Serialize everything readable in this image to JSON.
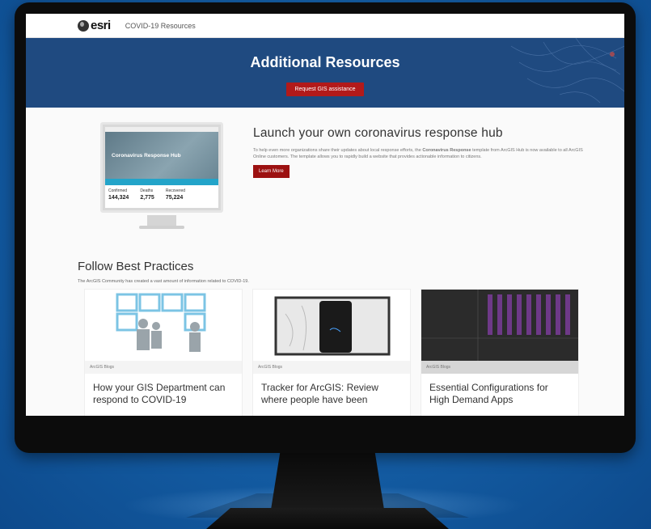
{
  "nav": {
    "logo": "esri",
    "link": "COVID-19 Resources"
  },
  "banner": {
    "title": "Additional Resources",
    "button": "Request GIS assistance"
  },
  "hub": {
    "mini_title": "Coronavirus Response Hub",
    "mini_stats": [
      {
        "label": "Confirmed",
        "value": "144,324"
      },
      {
        "label": "Deaths",
        "value": "2,775"
      },
      {
        "label": "Recovered",
        "value": "75,224"
      }
    ],
    "title": "Launch your own coronavirus response hub",
    "text_1": "To help even more organizations share their updates about local response efforts, the ",
    "text_strong": "Coronavirus Response",
    "text_2": " template from ArcGIS Hub is now available to all ArcGIS Online customers. The template allows you to rapidly build a website that provides actionable information to citizens.",
    "button": "Learn More"
  },
  "best": {
    "title": "Follow Best Practices",
    "subtitle": "The ArcGIS Community has created a vast amount of information related to COVID-19."
  },
  "cards": [
    {
      "tag": "ArcGIS Blogs",
      "title": "How your GIS Department can respond to COVID-19"
    },
    {
      "tag": "ArcGIS Blogs",
      "title": "Tracker for ArcGIS: Review where people have been"
    },
    {
      "tag": "ArcGIS Blogs",
      "title": "Essential Configurations for High Demand Apps"
    }
  ],
  "colors": {
    "banner": "#1f4a80",
    "accent_red": "#b21a1a",
    "background": "#1560a8"
  }
}
